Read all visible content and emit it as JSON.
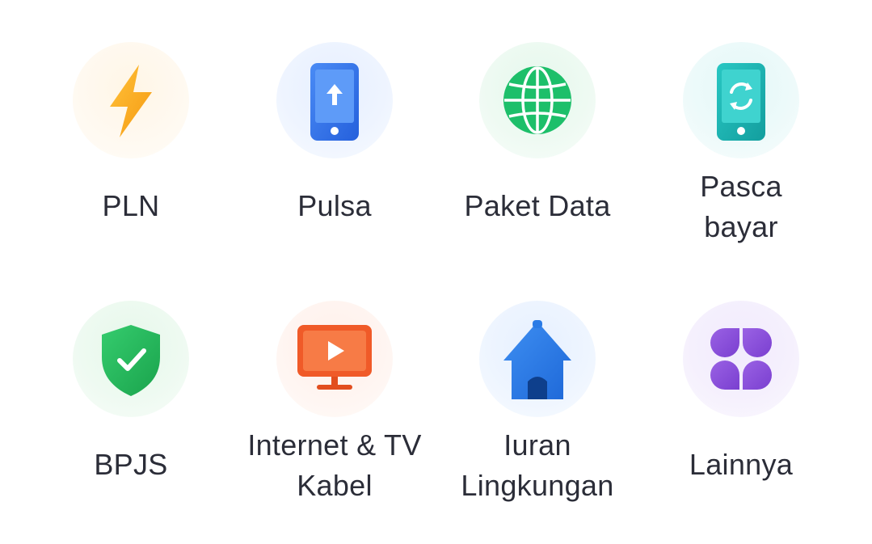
{
  "menu": {
    "items": [
      {
        "label": "PLN",
        "icon": "lightning-icon",
        "color": "#F7A825"
      },
      {
        "label": "Pulsa",
        "icon": "phone-topup-icon",
        "color": "#2F6FE8"
      },
      {
        "label": "Paket Data",
        "icon": "globe-icon",
        "color": "#1DBF6A"
      },
      {
        "label": "Pasca\nbayar",
        "icon": "phone-sync-icon",
        "color": "#17B3B3"
      },
      {
        "label": "BPJS",
        "icon": "shield-check-icon",
        "color": "#22B358"
      },
      {
        "label": "Internet & TV\nKabel",
        "icon": "tv-play-icon",
        "color": "#F05A28"
      },
      {
        "label": "Iuran\nLingkungan",
        "icon": "house-icon",
        "color": "#2A7BE6"
      },
      {
        "label": "Lainnya",
        "icon": "grid-more-icon",
        "color": "#8A4FD9"
      }
    ]
  }
}
